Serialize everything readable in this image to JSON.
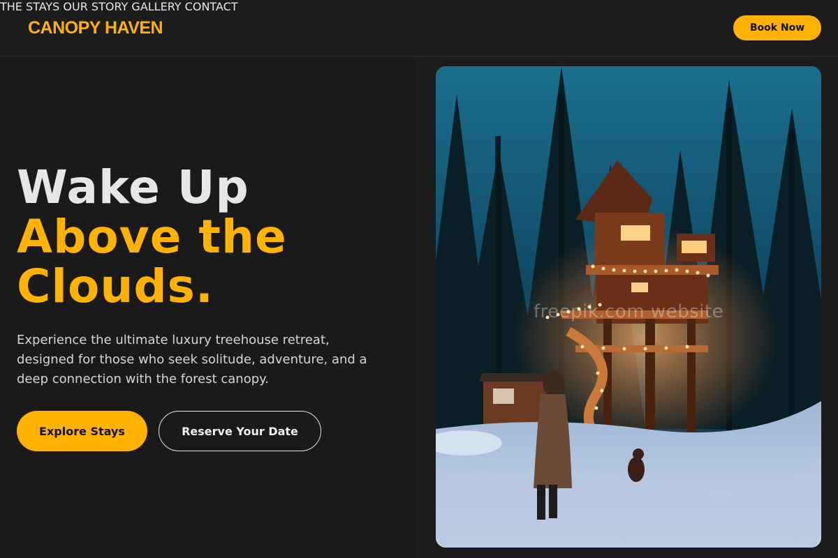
{
  "header": {
    "logo": "CANOPY HAVEN",
    "nav": [
      {
        "label": "THE STAYS"
      },
      {
        "label": "OUR STORY"
      },
      {
        "label": "GALLERY"
      },
      {
        "label": "CONTACT"
      }
    ],
    "cta_label": "Book Now"
  },
  "hero": {
    "headline_line1": "Wake Up",
    "headline_line2": "Above the",
    "headline_line3": "Clouds.",
    "lead": "Experience the ultimate luxury treehouse retreat, designed for those who seek solitude, adventure, and a deep connection with the forest canopy.",
    "primary_button": "Explore Stays",
    "secondary_button": "Reserve Your Date"
  },
  "image": {
    "description_icon": "treehouse-photo",
    "watermark": "freepik.com website"
  },
  "colors": {
    "accent": "#ffb300",
    "background": "#1a1a1a",
    "text": "#e6e6e6"
  }
}
